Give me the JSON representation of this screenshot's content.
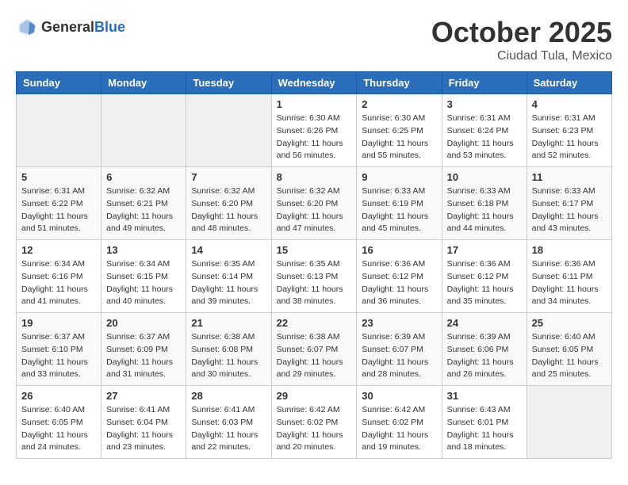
{
  "header": {
    "logo_general": "General",
    "logo_blue": "Blue",
    "month": "October 2025",
    "location": "Ciudad Tula, Mexico"
  },
  "weekdays": [
    "Sunday",
    "Monday",
    "Tuesday",
    "Wednesday",
    "Thursday",
    "Friday",
    "Saturday"
  ],
  "weeks": [
    [
      {
        "day": "",
        "info": ""
      },
      {
        "day": "",
        "info": ""
      },
      {
        "day": "",
        "info": ""
      },
      {
        "day": "1",
        "info": "Sunrise: 6:30 AM\nSunset: 6:26 PM\nDaylight: 11 hours\nand 56 minutes."
      },
      {
        "day": "2",
        "info": "Sunrise: 6:30 AM\nSunset: 6:25 PM\nDaylight: 11 hours\nand 55 minutes."
      },
      {
        "day": "3",
        "info": "Sunrise: 6:31 AM\nSunset: 6:24 PM\nDaylight: 11 hours\nand 53 minutes."
      },
      {
        "day": "4",
        "info": "Sunrise: 6:31 AM\nSunset: 6:23 PM\nDaylight: 11 hours\nand 52 minutes."
      }
    ],
    [
      {
        "day": "5",
        "info": "Sunrise: 6:31 AM\nSunset: 6:22 PM\nDaylight: 11 hours\nand 51 minutes."
      },
      {
        "day": "6",
        "info": "Sunrise: 6:32 AM\nSunset: 6:21 PM\nDaylight: 11 hours\nand 49 minutes."
      },
      {
        "day": "7",
        "info": "Sunrise: 6:32 AM\nSunset: 6:20 PM\nDaylight: 11 hours\nand 48 minutes."
      },
      {
        "day": "8",
        "info": "Sunrise: 6:32 AM\nSunset: 6:20 PM\nDaylight: 11 hours\nand 47 minutes."
      },
      {
        "day": "9",
        "info": "Sunrise: 6:33 AM\nSunset: 6:19 PM\nDaylight: 11 hours\nand 45 minutes."
      },
      {
        "day": "10",
        "info": "Sunrise: 6:33 AM\nSunset: 6:18 PM\nDaylight: 11 hours\nand 44 minutes."
      },
      {
        "day": "11",
        "info": "Sunrise: 6:33 AM\nSunset: 6:17 PM\nDaylight: 11 hours\nand 43 minutes."
      }
    ],
    [
      {
        "day": "12",
        "info": "Sunrise: 6:34 AM\nSunset: 6:16 PM\nDaylight: 11 hours\nand 41 minutes."
      },
      {
        "day": "13",
        "info": "Sunrise: 6:34 AM\nSunset: 6:15 PM\nDaylight: 11 hours\nand 40 minutes."
      },
      {
        "day": "14",
        "info": "Sunrise: 6:35 AM\nSunset: 6:14 PM\nDaylight: 11 hours\nand 39 minutes."
      },
      {
        "day": "15",
        "info": "Sunrise: 6:35 AM\nSunset: 6:13 PM\nDaylight: 11 hours\nand 38 minutes."
      },
      {
        "day": "16",
        "info": "Sunrise: 6:36 AM\nSunset: 6:12 PM\nDaylight: 11 hours\nand 36 minutes."
      },
      {
        "day": "17",
        "info": "Sunrise: 6:36 AM\nSunset: 6:12 PM\nDaylight: 11 hours\nand 35 minutes."
      },
      {
        "day": "18",
        "info": "Sunrise: 6:36 AM\nSunset: 6:11 PM\nDaylight: 11 hours\nand 34 minutes."
      }
    ],
    [
      {
        "day": "19",
        "info": "Sunrise: 6:37 AM\nSunset: 6:10 PM\nDaylight: 11 hours\nand 33 minutes."
      },
      {
        "day": "20",
        "info": "Sunrise: 6:37 AM\nSunset: 6:09 PM\nDaylight: 11 hours\nand 31 minutes."
      },
      {
        "day": "21",
        "info": "Sunrise: 6:38 AM\nSunset: 6:08 PM\nDaylight: 11 hours\nand 30 minutes."
      },
      {
        "day": "22",
        "info": "Sunrise: 6:38 AM\nSunset: 6:07 PM\nDaylight: 11 hours\nand 29 minutes."
      },
      {
        "day": "23",
        "info": "Sunrise: 6:39 AM\nSunset: 6:07 PM\nDaylight: 11 hours\nand 28 minutes."
      },
      {
        "day": "24",
        "info": "Sunrise: 6:39 AM\nSunset: 6:06 PM\nDaylight: 11 hours\nand 26 minutes."
      },
      {
        "day": "25",
        "info": "Sunrise: 6:40 AM\nSunset: 6:05 PM\nDaylight: 11 hours\nand 25 minutes."
      }
    ],
    [
      {
        "day": "26",
        "info": "Sunrise: 6:40 AM\nSunset: 6:05 PM\nDaylight: 11 hours\nand 24 minutes."
      },
      {
        "day": "27",
        "info": "Sunrise: 6:41 AM\nSunset: 6:04 PM\nDaylight: 11 hours\nand 23 minutes."
      },
      {
        "day": "28",
        "info": "Sunrise: 6:41 AM\nSunset: 6:03 PM\nDaylight: 11 hours\nand 22 minutes."
      },
      {
        "day": "29",
        "info": "Sunrise: 6:42 AM\nSunset: 6:02 PM\nDaylight: 11 hours\nand 20 minutes."
      },
      {
        "day": "30",
        "info": "Sunrise: 6:42 AM\nSunset: 6:02 PM\nDaylight: 11 hours\nand 19 minutes."
      },
      {
        "day": "31",
        "info": "Sunrise: 6:43 AM\nSunset: 6:01 PM\nDaylight: 11 hours\nand 18 minutes."
      },
      {
        "day": "",
        "info": ""
      }
    ]
  ]
}
